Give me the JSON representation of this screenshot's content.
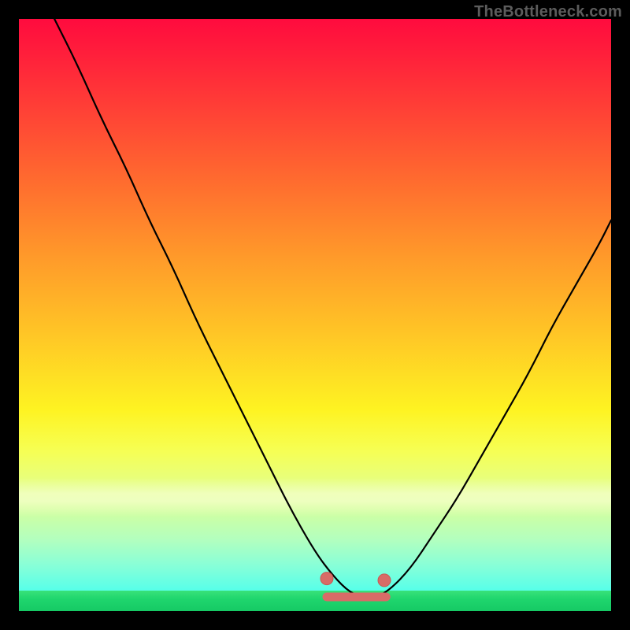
{
  "watermark": {
    "text": "TheBottleneck.com"
  },
  "palette": {
    "curve": "#000000",
    "marker": "#d86b67",
    "marker_outline": "#c75a55"
  },
  "chart_data": {
    "type": "line",
    "title": "",
    "xlabel": "",
    "ylabel": "",
    "xlim": [
      0,
      100
    ],
    "ylim": [
      0,
      100
    ],
    "grid": false,
    "legend": false,
    "series": [
      {
        "name": "bottleneck-curve",
        "x": [
          6,
          10,
          14,
          18,
          22,
          26,
          30,
          34,
          38,
          42,
          46,
          50,
          53,
          56,
          59,
          62,
          66,
          70,
          74,
          78,
          82,
          86,
          90,
          94,
          98,
          100
        ],
        "y": [
          100,
          92,
          83,
          75,
          66,
          58,
          49,
          41,
          33,
          25,
          17,
          10,
          6,
          3,
          2,
          3,
          7,
          13,
          19,
          26,
          33,
          40,
          48,
          55,
          62,
          66
        ]
      }
    ],
    "optimal_zone": {
      "x_start": 52,
      "x_end": 62,
      "y": 2.4,
      "markers": [
        {
          "x": 52.0,
          "y": 5.5
        },
        {
          "x": 61.7,
          "y": 5.2
        }
      ]
    },
    "background": {
      "top_color": "#ff0b3e",
      "bottom_color": "#16c964",
      "description": "vertical red→green heat gradient"
    }
  }
}
